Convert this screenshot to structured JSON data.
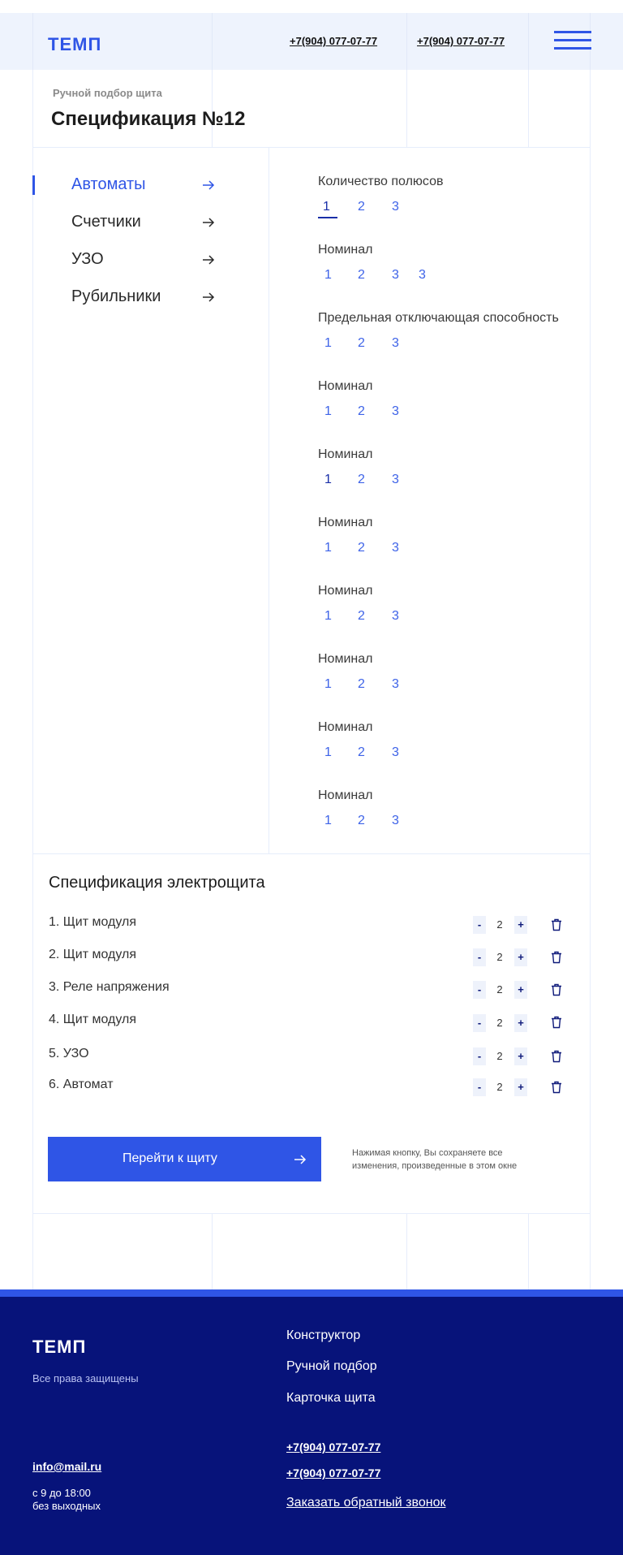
{
  "header": {
    "logo": "ТЕМП",
    "phone_1": "+7(904) 077-07-77",
    "phone_2": "+7(904) 077-07-77",
    "menu_icon": "burger-menu-icon"
  },
  "breadcrumb": "Ручной подбор щита",
  "title": "Спецификация №12",
  "sidebar": {
    "items": [
      {
        "label": "Автоматы",
        "active": true
      },
      {
        "label": "Счетчики",
        "active": false
      },
      {
        "label": "УЗО",
        "active": false
      },
      {
        "label": "Рубильники",
        "active": false
      }
    ]
  },
  "filters": [
    {
      "label": "Количество полюсов",
      "options": [
        "1",
        "2",
        "3"
      ],
      "selected": "1"
    },
    {
      "label": "Номинал",
      "options": [
        "1",
        "2",
        "3",
        "3"
      ]
    },
    {
      "label": "Предельная отключающая способность",
      "options": [
        "1",
        "2",
        "3"
      ]
    },
    {
      "label": "Номинал",
      "options": [
        "1",
        "2",
        "3"
      ]
    },
    {
      "label": "Номинал",
      "options": [
        "1",
        "2",
        "3"
      ]
    },
    {
      "label": "Номинал",
      "options": [
        "1",
        "2",
        "3"
      ]
    },
    {
      "label": "Номинал",
      "options": [
        "1",
        "2",
        "3"
      ]
    },
    {
      "label": "Номинал",
      "options": [
        "1",
        "2",
        "3"
      ]
    },
    {
      "label": "Номинал",
      "options": [
        "1",
        "2",
        "3"
      ]
    },
    {
      "label": "Номинал",
      "options": [
        "1",
        "2",
        "3"
      ]
    }
  ],
  "spec": {
    "title": "Спецификация электрощита",
    "items": [
      {
        "name": "1. Щит модуля",
        "qty": "2"
      },
      {
        "name": "2. Щит модуля",
        "qty": "2"
      },
      {
        "name": "3. Реле напряжения",
        "qty": "2"
      },
      {
        "name": "4. Щит модуля",
        "qty": "2"
      },
      {
        "name": "5. УЗО",
        "qty": "2"
      },
      {
        "name": "6. Автомат",
        "qty": "2"
      }
    ],
    "minus": "-",
    "plus": "+",
    "button": "Перейти к щиту",
    "note": "Нажимая кнопку, Вы сохраняете все изменения, произведенные в этом окне"
  },
  "footer": {
    "logo": "ТЕМП",
    "rights": "Все права защищены",
    "nav": [
      "Конструктор",
      "Ручной подбор",
      "Карточка щита"
    ],
    "phone_1": "+7(904) 077-07-77",
    "phone_2": "+7(904) 077-07-77",
    "callback": "Заказать обратный звонок",
    "email": "info@mail.ru",
    "hours_1": "с 9 до 18:00",
    "hours_2": "без выходных"
  },
  "colors": {
    "accent": "#2f55e6",
    "footer_bg": "#07137a",
    "header_bg": "#eef3fd"
  }
}
